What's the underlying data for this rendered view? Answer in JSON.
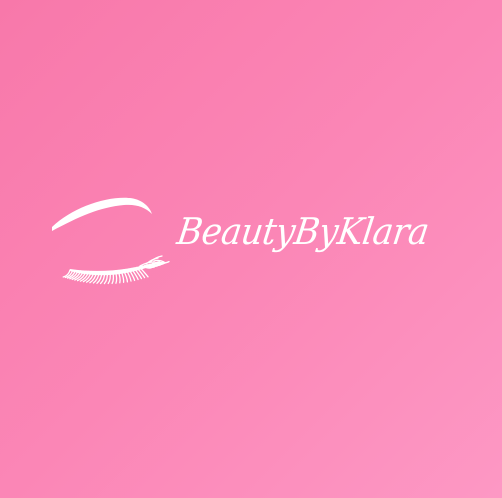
{
  "brand": {
    "name": "BeautyByKlara"
  },
  "logo": {
    "icon": "eyebrow-and-closed-eye-lash-icon",
    "color": "#ffffff"
  },
  "colors": {
    "background_start": "#f878aa",
    "background_end": "#fd98c4"
  }
}
